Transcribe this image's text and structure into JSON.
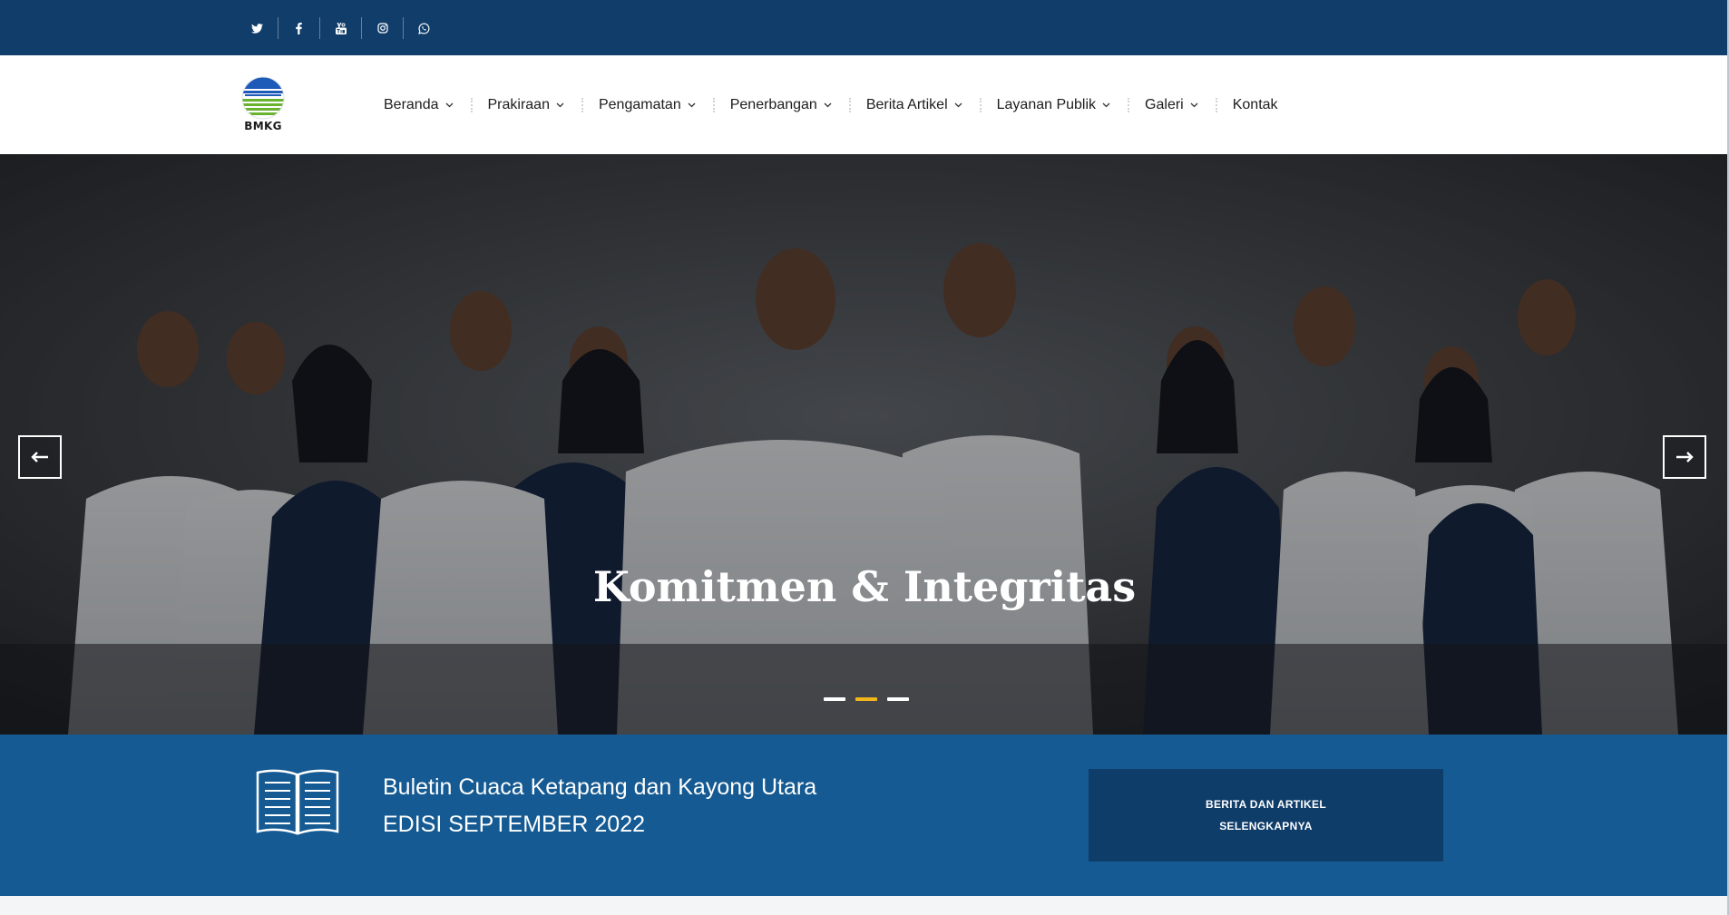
{
  "topbar": {
    "socials": [
      {
        "name": "twitter-icon"
      },
      {
        "name": "facebook-icon"
      },
      {
        "name": "youtube-icon"
      },
      {
        "name": "instagram-icon"
      },
      {
        "name": "whatsapp-icon"
      }
    ],
    "background_color": "#113d6b"
  },
  "header": {
    "logo_text": "BMKG",
    "nav": {
      "beranda": "Beranda",
      "prakiraan": "Prakiraan",
      "pengamatan": "Pengamatan",
      "penerbangan": "Penerbangan",
      "berita_artikel": "Berita Artikel",
      "layanan_publik": "Layanan Publik",
      "galeri": "Galeri",
      "kontak": "Kontak"
    }
  },
  "hero": {
    "slide_title": "Komitmen & Integritas",
    "slide_count": 3,
    "active_slide": 2,
    "active_dot_color": "#f2b51c"
  },
  "banner": {
    "title": "Buletin Cuaca Ketapang dan Kayong Utara",
    "edition": "EDISI SEPTEMBER 2022",
    "button_line1": "BERITA DAN ARTIKEL",
    "button_line2": "SELENGKAPNYA",
    "background_color": "#155a92",
    "button_color": "#0f3d6a"
  }
}
